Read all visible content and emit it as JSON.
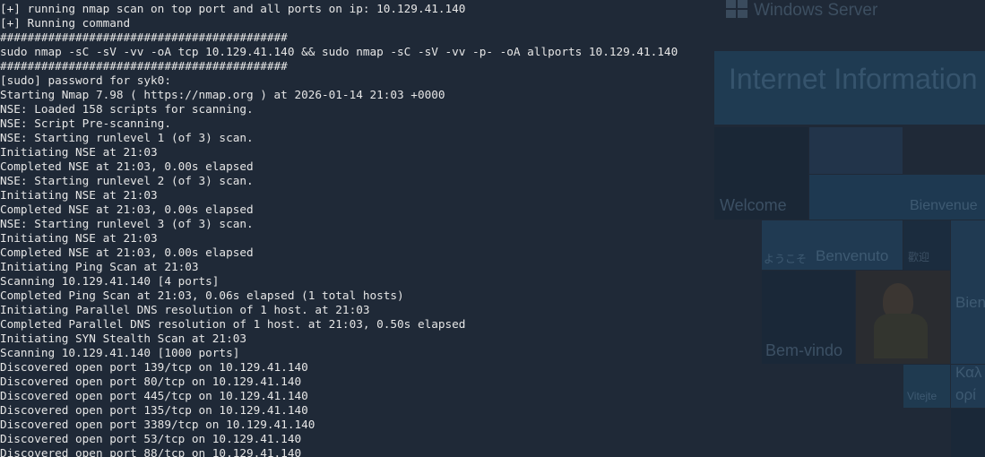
{
  "background": {
    "brand": "Windows Server",
    "heading": "Internet Information",
    "welcome_words": [
      {
        "key": "welcome",
        "text": "Welcome"
      },
      {
        "key": "bienvenue",
        "text": "Bienvenue"
      },
      {
        "key": "youkoso",
        "text": "ようこそ"
      },
      {
        "key": "benvenuto",
        "text": "Benvenuto"
      },
      {
        "key": "huanying",
        "text": "歡迎"
      },
      {
        "key": "bienv",
        "text": "Bien"
      },
      {
        "key": "bemvindo",
        "text": "Bem-vindo"
      },
      {
        "key": "vitejte",
        "text": "Vitejte"
      },
      {
        "key": "kalos",
        "text": "Καλ"
      },
      {
        "key": "orisate",
        "text": "ορί"
      }
    ],
    "colors": {
      "terminal_bg": "#1f2937",
      "tile_dark": "#1a2838",
      "tile_light": "#24384b",
      "tile_blue": "#1f3d55",
      "text_dim": "#3a4f63"
    }
  },
  "terminal": {
    "lines": [
      "[+] running nmap scan on top port and all ports on ip: 10.129.41.140",
      "[+] Running command",
      "##########################################",
      "sudo nmap -sC -sV -vv -oA tcp 10.129.41.140 && sudo nmap -sC -sV -vv -p- -oA allports 10.129.41.140",
      "##########################################",
      "[sudo] password for syk0:",
      "Starting Nmap 7.98 ( https://nmap.org ) at 2026-01-14 21:03 +0000",
      "NSE: Loaded 158 scripts for scanning.",
      "NSE: Script Pre-scanning.",
      "NSE: Starting runlevel 1 (of 3) scan.",
      "Initiating NSE at 21:03",
      "Completed NSE at 21:03, 0.00s elapsed",
      "NSE: Starting runlevel 2 (of 3) scan.",
      "Initiating NSE at 21:03",
      "Completed NSE at 21:03, 0.00s elapsed",
      "NSE: Starting runlevel 3 (of 3) scan.",
      "Initiating NSE at 21:03",
      "Completed NSE at 21:03, 0.00s elapsed",
      "Initiating Ping Scan at 21:03",
      "Scanning 10.129.41.140 [4 ports]",
      "Completed Ping Scan at 21:03, 0.06s elapsed (1 total hosts)",
      "Initiating Parallel DNS resolution of 1 host. at 21:03",
      "Completed Parallel DNS resolution of 1 host. at 21:03, 0.50s elapsed",
      "Initiating SYN Stealth Scan at 21:03",
      "Scanning 10.129.41.140 [1000 ports]",
      "Discovered open port 139/tcp on 10.129.41.140",
      "Discovered open port 80/tcp on 10.129.41.140",
      "Discovered open port 445/tcp on 10.129.41.140",
      "Discovered open port 135/tcp on 10.129.41.140",
      "Discovered open port 3389/tcp on 10.129.41.140",
      "Discovered open port 53/tcp on 10.129.41.140",
      "Discovered open port 88/tcp on 10.129.41.140"
    ]
  }
}
